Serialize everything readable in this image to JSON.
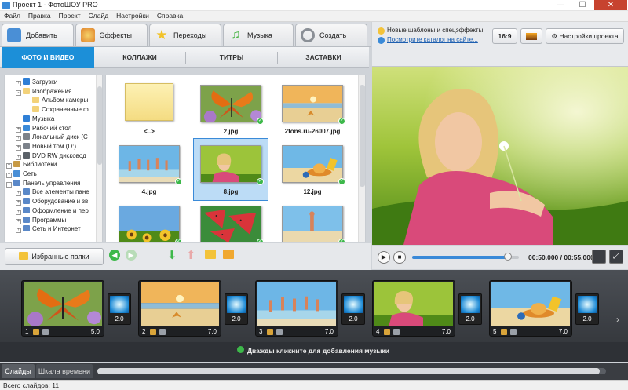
{
  "window": {
    "title": "Проект 1 - ФотоШОУ PRO",
    "minimize": "—",
    "maximize": "☐",
    "close": "✕"
  },
  "menu": [
    "Файл",
    "Правка",
    "Проект",
    "Слайд",
    "Настройки",
    "Справка"
  ],
  "main_tabs": [
    {
      "label": "Добавить",
      "icon": "add-photo-icon",
      "color": "#4a8fd6"
    },
    {
      "label": "Эффекты",
      "icon": "palette-icon",
      "color": "#e39a2d"
    },
    {
      "label": "Переходы",
      "icon": "star-icon",
      "color": "#f2c32a"
    },
    {
      "label": "Музыка",
      "icon": "music-icon",
      "color": "#4cb548"
    },
    {
      "label": "Создать",
      "icon": "film-reel-icon",
      "color": "#8a8f96"
    }
  ],
  "news": {
    "line1": "Новые шаблоны и спецэффекты",
    "line2": "Посмотрите каталог на сайте..."
  },
  "aspect_button": "16:9",
  "settings_button": "Настройки проекта",
  "sub_tabs": [
    "ФОТО И ВИДЕО",
    "КОЛЛАЖИ",
    "ТИТРЫ",
    "ЗАСТАВКИ"
  ],
  "tree": [
    {
      "label": "Загрузки",
      "level": 1,
      "icon": "download-icon",
      "exp": "+"
    },
    {
      "label": "Изображения",
      "level": 1,
      "icon": "folder-icon",
      "exp": "-"
    },
    {
      "label": "Альбом камеры",
      "level": 2,
      "icon": "folder-icon",
      "exp": ""
    },
    {
      "label": "Сохраненные ф",
      "level": 2,
      "icon": "folder-icon",
      "exp": ""
    },
    {
      "label": "Музыка",
      "level": 1,
      "icon": "music-note-icon",
      "exp": ""
    },
    {
      "label": "Рабочий стол",
      "level": 1,
      "icon": "desktop-icon",
      "exp": "+"
    },
    {
      "label": "Локальный диск (C",
      "level": 1,
      "icon": "drive-icon",
      "exp": "+"
    },
    {
      "label": "Новый том (D:)",
      "level": 1,
      "icon": "drive-icon",
      "exp": "+"
    },
    {
      "label": "DVD RW дисковод",
      "level": 1,
      "icon": "dvd-icon",
      "exp": "+"
    },
    {
      "label": "Библиотеки",
      "level": 0,
      "icon": "library-icon",
      "exp": "+"
    },
    {
      "label": "Сеть",
      "level": 0,
      "icon": "network-icon",
      "exp": "+"
    },
    {
      "label": "Панель управления",
      "level": 0,
      "icon": "control-panel-icon",
      "exp": "-"
    },
    {
      "label": "Все элементы пане",
      "level": 1,
      "icon": "control-panel-icon",
      "exp": "+"
    },
    {
      "label": "Оборудование и зв",
      "level": 1,
      "icon": "control-panel-icon",
      "exp": "+"
    },
    {
      "label": "Оформление и пер",
      "level": 1,
      "icon": "control-panel-icon",
      "exp": "+"
    },
    {
      "label": "Программы",
      "level": 1,
      "icon": "control-panel-icon",
      "exp": "+"
    },
    {
      "label": "Сеть и Интернет",
      "level": 1,
      "icon": "control-panel-icon",
      "exp": "+"
    }
  ],
  "files": [
    {
      "name": "<..>",
      "kind": "folder"
    },
    {
      "name": "2.jpg",
      "kind": "butterfly"
    },
    {
      "name": "2fons.ru-26007.jpg",
      "kind": "beach-star"
    },
    {
      "name": "4.jpg",
      "kind": "jumping"
    },
    {
      "name": "8.jpg",
      "kind": "girl",
      "selected": true
    },
    {
      "name": "12.jpg",
      "kind": "hat-beach"
    },
    {
      "name": "",
      "kind": "sunflowers"
    },
    {
      "name": "",
      "kind": "watermelon"
    },
    {
      "name": "",
      "kind": "pose"
    }
  ],
  "favorites_button": "Избранные папки",
  "player": {
    "current": "00:50.000",
    "separator": " / ",
    "total": "00:55.000",
    "progress": 0.9
  },
  "slides": [
    {
      "num": "1",
      "dur": "5.0",
      "kind": "butterfly"
    },
    {
      "num": "2",
      "dur": "7.0",
      "kind": "beach-star"
    },
    {
      "num": "3",
      "dur": "7.0",
      "kind": "jumping"
    },
    {
      "num": "4",
      "dur": "7.0",
      "kind": "girl"
    },
    {
      "num": "5",
      "dur": "7.0",
      "kind": "hat-beach"
    }
  ],
  "transitions": [
    "2.0",
    "2.0",
    "2.0",
    "2.0",
    "2.0"
  ],
  "music_hint": "Дважды кликните для добавления музыки",
  "bottom_tabs": [
    "Слайды",
    "Шкала времени"
  ],
  "status": "Всего слайдов: 11"
}
